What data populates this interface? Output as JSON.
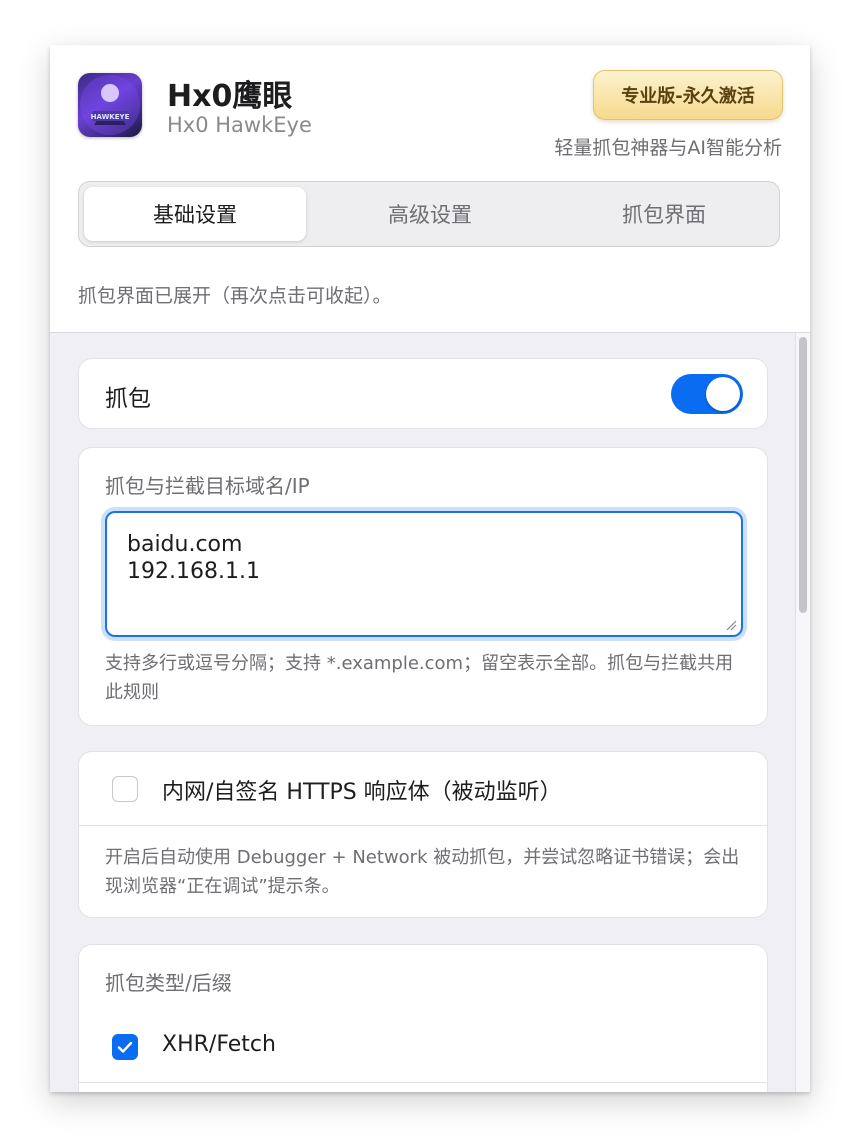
{
  "app": {
    "title": "Hx0鹰眼",
    "subtitle": "Hx0 HawkEye",
    "badge": "专业版-永久激活",
    "tagline": "轻量抓包神器与AI智能分析"
  },
  "tabs": [
    {
      "label": "基础设置",
      "active": true
    },
    {
      "label": "高级设置",
      "active": false
    },
    {
      "label": "抓包界面",
      "active": false
    }
  ],
  "status": "抓包界面已展开（再次点击可收起）。",
  "capture": {
    "label": "抓包",
    "enabled": true
  },
  "target": {
    "label": "抓包与拦截目标域名/IP",
    "lines": [
      "baidu.com",
      "192.168.1.1"
    ],
    "help": "支持多行或逗号分隔；支持 *.example.com；留空表示全部。抓包与拦截共用此规则"
  },
  "https": {
    "label": "内网/自签名 HTTPS 响应体（被动监听）",
    "checked": false,
    "help": "开启后自动使用 Debugger + Network 被动抓包，并尝试忽略证书错误；会出现浏览器“正在调试”提示条。"
  },
  "types": {
    "label": "抓包类型/后缀",
    "items": [
      {
        "label": "XHR/Fetch",
        "checked": true
      }
    ]
  },
  "colors": {
    "accent": "#0a6cf0",
    "badge_text": "#5a4010"
  }
}
